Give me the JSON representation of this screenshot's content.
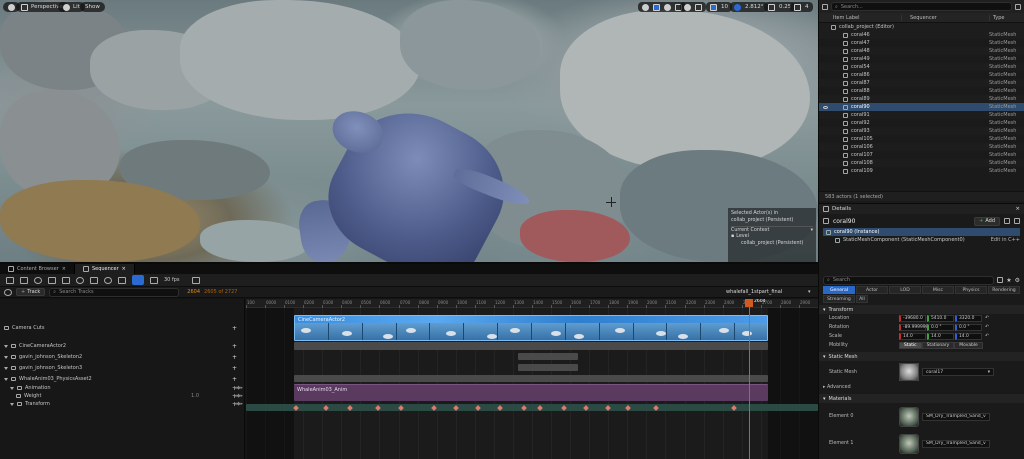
{
  "viewport": {
    "menu_label": "",
    "perspective_label": "Perspective",
    "lit_label": "Lit",
    "show_label": "Show",
    "grid_snap_value": "10",
    "angle_snap_value": "2.812°",
    "scale_snap_value": "0.25",
    "camera_speed_value": "4",
    "context": {
      "selected_actors": "Selected Actor(s) in",
      "selected_level": "collab_project (Persistent)",
      "current_context_label": "Current Context",
      "level_label": "Level",
      "level_value": "collab_project (Persistent)"
    }
  },
  "outliner": {
    "search_placeholder": "Search...",
    "col_item_label": "Item Label",
    "col_sequencer": "Sequencer",
    "col_type": "Type",
    "project_row": "collab_project (Editor)",
    "rows": [
      {
        "label": "coral46",
        "type": "StaticMesh"
      },
      {
        "label": "coral47",
        "type": "StaticMesh"
      },
      {
        "label": "coral48",
        "type": "StaticMesh"
      },
      {
        "label": "coral49",
        "type": "StaticMesh"
      },
      {
        "label": "coral54",
        "type": "StaticMesh"
      },
      {
        "label": "coral86",
        "type": "StaticMesh"
      },
      {
        "label": "coral87",
        "type": "StaticMesh"
      },
      {
        "label": "coral88",
        "type": "StaticMesh"
      },
      {
        "label": "coral89",
        "type": "StaticMesh"
      },
      {
        "label": "coral90",
        "type": "StaticMesh"
      },
      {
        "label": "coral91",
        "type": "StaticMesh"
      },
      {
        "label": "coral92",
        "type": "StaticMesh"
      },
      {
        "label": "coral93",
        "type": "StaticMesh"
      },
      {
        "label": "coral105",
        "type": "StaticMesh"
      },
      {
        "label": "coral106",
        "type": "StaticMesh"
      },
      {
        "label": "coral107",
        "type": "StaticMesh"
      },
      {
        "label": "coral108",
        "type": "StaticMesh"
      },
      {
        "label": "coral109",
        "type": "StaticMesh"
      }
    ],
    "footer": "583 actors (1 selected)"
  },
  "details": {
    "tab_label": "Details",
    "actor_name": "coral90",
    "add_label": "Add",
    "instance_row": "coral90 (Instance)",
    "component_row": "StaticMeshComponent (StaticMeshComponent0)",
    "edit_cpp": "Edit in C++",
    "search_placeholder": "Search",
    "categories": [
      "General",
      "Actor",
      "LOD",
      "Misc",
      "Physics",
      "Rendering",
      "Streaming",
      "All"
    ],
    "transform_label": "Transform",
    "location_label": "Location",
    "location": [
      "-39680.0",
      "5410.0",
      "3320.0"
    ],
    "rotation_label": "Rotation",
    "rotation": [
      "-89.999999",
      "0.0 °",
      "0.0 °"
    ],
    "scale_label": "Scale",
    "scale": [
      "14.0",
      "14.0",
      "14.0"
    ],
    "mobility_label": "Mobility",
    "mobility_options": [
      "Static",
      "Stationary",
      "Movable"
    ],
    "static_mesh_section": "Static Mesh",
    "static_mesh_label": "Static Mesh",
    "static_mesh_value": "coral17",
    "advanced_label": "Advanced",
    "materials_section": "Materials",
    "element0_label": "Element 0",
    "element0_value": "SM_Dry_Trampled_Sand_vdcpe",
    "element1_label": "Element 1",
    "element1_value": "SM_Dry_Trampled_Sand_vdcpe"
  },
  "bottom": {
    "tab_content_browser": "Content Browser",
    "tab_sequencer": "Sequencer",
    "fps_label": "30 fps",
    "track_button": "Track",
    "search_tracks_placeholder": "Search Tracks",
    "current_frame": "2604",
    "frame_readout": "2605 of 2727",
    "sequence_name": "whalefall_1stpart_final",
    "playhead_label": "2604",
    "tracks": [
      {
        "label": "Camera Cuts"
      },
      {
        "label": "CineCameraActor2"
      },
      {
        "label": "gavin_johnson_Skeleton2"
      },
      {
        "label": "gavin_johnson_Skeleton3"
      },
      {
        "label": "WhaleAnim03_PhysicsAsset2"
      },
      {
        "label": "Animation"
      },
      {
        "label": "Weight",
        "value": "1.0"
      },
      {
        "label": "Transform"
      }
    ],
    "camera_section_label": "CineCameraActor2",
    "anim_section_label": "WhaleAnim03_Anim",
    "ruler_labels": [
      "100",
      "0000",
      "0100",
      "0200",
      "0300",
      "0400",
      "0500",
      "0600",
      "0700",
      "0800",
      "0900",
      "1000",
      "1100",
      "1200",
      "1300",
      "1400",
      "1500",
      "1600",
      "1700",
      "1800",
      "1900",
      "2000",
      "2100",
      "2200",
      "2300",
      "2400",
      "2500",
      "2700",
      "2800",
      "2900"
    ]
  }
}
